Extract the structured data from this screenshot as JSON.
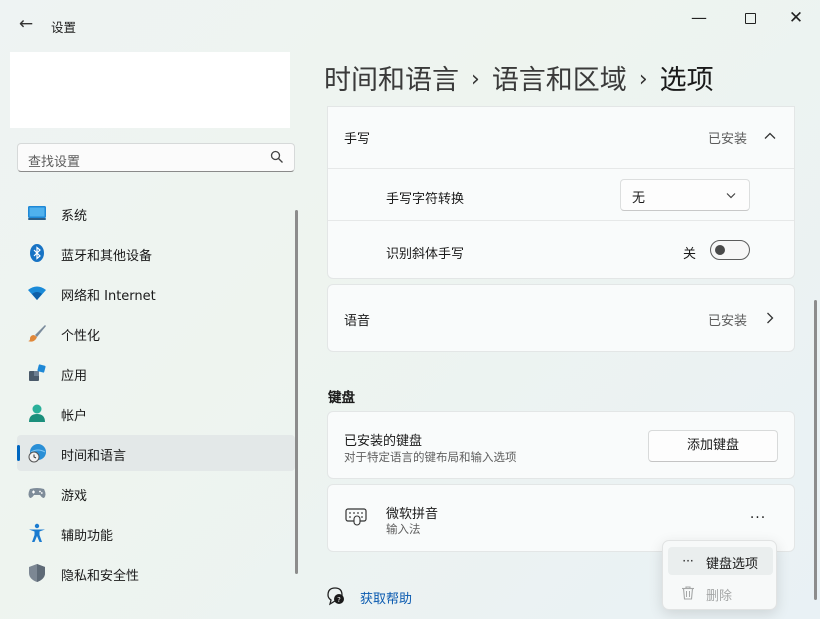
{
  "window": {
    "title": "设置",
    "back_glyph": "←",
    "minimize_glyph": "—",
    "close_glyph": "✕"
  },
  "sidebar": {
    "search_placeholder": "查找设置",
    "items": [
      {
        "label": "系统",
        "icon": "system-icon"
      },
      {
        "label": "蓝牙和其他设备",
        "icon": "bluetooth-icon"
      },
      {
        "label": "网络和 Internet",
        "icon": "wifi-icon"
      },
      {
        "label": "个性化",
        "icon": "brush-icon"
      },
      {
        "label": "应用",
        "icon": "apps-icon"
      },
      {
        "label": "帐户",
        "icon": "account-icon"
      },
      {
        "label": "时间和语言",
        "icon": "time-language-icon",
        "selected": true
      },
      {
        "label": "游戏",
        "icon": "gamepad-icon"
      },
      {
        "label": "辅助功能",
        "icon": "accessibility-icon"
      },
      {
        "label": "隐私和安全性",
        "icon": "shield-icon"
      }
    ]
  },
  "breadcrumb": {
    "level1": "时间和语言",
    "level2": "语言和区域",
    "current": "选项",
    "separator": "›"
  },
  "handwriting": {
    "title": "手写",
    "status": "已安装",
    "conversion_label": "手写字符转换",
    "conversion_value": "无",
    "italic_label": "识别斜体手写",
    "italic_state": "关"
  },
  "speech": {
    "title": "语音",
    "status": "已安装"
  },
  "keyboard": {
    "section_title": "键盘",
    "installed_title": "已安装的键盘",
    "installed_desc": "对于特定语言的键布局和输入选项",
    "add_button": "添加键盘",
    "item_name": "微软拼音",
    "item_type": "输入法",
    "more_glyph": "···"
  },
  "context_menu": {
    "items": [
      {
        "label": "键盘选项",
        "glyph": "···",
        "enabled": true
      },
      {
        "label": "删除",
        "enabled": false
      }
    ]
  },
  "help": {
    "label": "获取帮助"
  },
  "colors": {
    "accent": "#0067c0",
    "link": "#0a5ab0"
  }
}
